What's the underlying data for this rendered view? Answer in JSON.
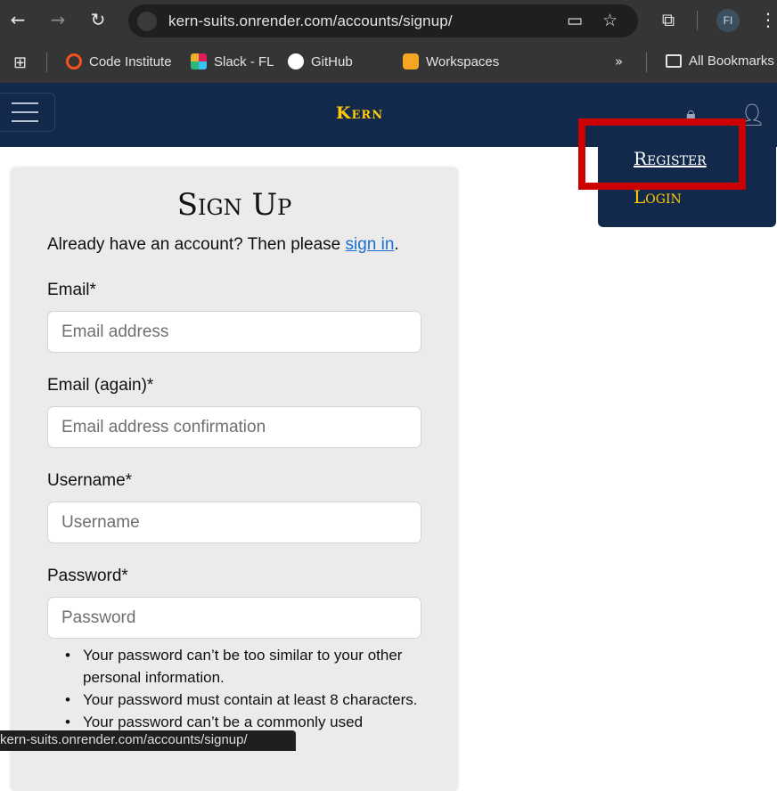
{
  "browser": {
    "url": "kern-suits.onrender.com/accounts/signup/",
    "profile_initials": "FI",
    "bookmarks": [
      {
        "label": "Code Institute",
        "icon": "code-institute-icon",
        "color": "#f4511e"
      },
      {
        "label": "Slack - FL",
        "icon": "slack-icon",
        "color": "#e01e5a"
      },
      {
        "label": "GitHub",
        "icon": "github-icon",
        "color": "#ffffff"
      },
      {
        "label": "Workspaces",
        "icon": "workspaces-icon",
        "color": "#f5a623"
      }
    ],
    "all_bookmarks_label": "All Bookmarks",
    "status_url": "kern-suits.onrender.com/accounts/signup/"
  },
  "site": {
    "brand": "Kern",
    "dropdown": {
      "register_label": "Register",
      "login_label": "Login"
    }
  },
  "form": {
    "title": "Sign Up",
    "lead_text": "Already have an account? Then please ",
    "lead_link": "sign in",
    "lead_end": ".",
    "fields": [
      {
        "label": "Email*",
        "placeholder": "Email address"
      },
      {
        "label": "Email (again)*",
        "placeholder": "Email address confirmation"
      },
      {
        "label": "Username*",
        "placeholder": "Username"
      },
      {
        "label": "Password*",
        "placeholder": "Password"
      }
    ],
    "password_hints": [
      "Your password can’t be too similar to your other personal information.",
      "Your password must contain at least 8 characters.",
      "Your password can’t be a commonly used"
    ]
  },
  "colors": {
    "nav_bg": "#13294b",
    "brand_gold": "#ffcb05",
    "highlight_red": "#cc0000",
    "link_blue": "#1a6fd6"
  }
}
